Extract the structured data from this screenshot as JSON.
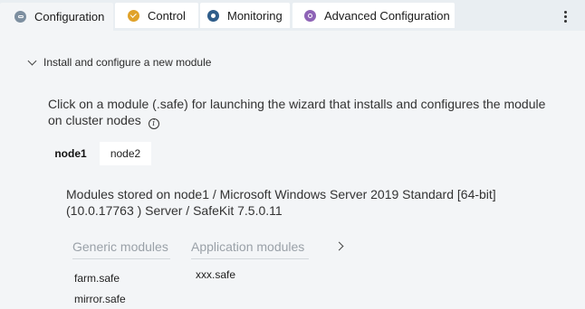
{
  "tabs": [
    {
      "label": "Configuration",
      "icon": "configuration-icon",
      "active": true
    },
    {
      "label": "Control",
      "icon": "control-icon",
      "active": false
    },
    {
      "label": "Monitoring",
      "icon": "monitoring-icon",
      "active": false
    },
    {
      "label": "Advanced Configuration",
      "icon": "advanced-configuration-icon",
      "active": false
    }
  ],
  "menu": {
    "icon": "more-vertical-icon"
  },
  "section": {
    "title": "Install and configure a new module",
    "expanded": true,
    "description": "Click on a module (.safe) for launching the wizard that installs and configures the module on cluster nodes",
    "info_glyph": "i"
  },
  "nodes": [
    {
      "label": "node1",
      "selected": true
    },
    {
      "label": "node2",
      "selected": false
    }
  ],
  "stored_info": "Modules stored on node1 / Microsoft Windows Server 2019 Standard [64-bit] (10.0.17763 ) Server / SafeKit 7.5.0.11",
  "module_tabs": {
    "generic_label": "Generic modules",
    "application_label": "Application modules"
  },
  "generic_modules": [
    "farm.safe",
    "mirror.safe"
  ],
  "application_modules": [
    "xxx.safe"
  ],
  "colors": {
    "background": "#e9eef2",
    "panel": "#f3f5f7",
    "control_icon": "#e0a22a",
    "monitoring_icon": "#2f5d8a",
    "advanced_icon": "#8e63b6",
    "configuration_icon": "#7d8fa0"
  }
}
